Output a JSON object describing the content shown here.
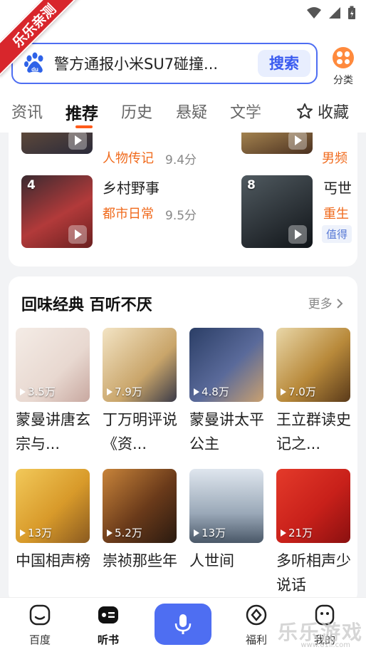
{
  "ribbon": "乐乐亲测",
  "search": {
    "query": "警方通报小米SU7碰撞...",
    "button": "搜索"
  },
  "category": {
    "label": "分类"
  },
  "tabs": [
    {
      "label": "资讯"
    },
    {
      "label": "推荐"
    },
    {
      "label": "历史"
    },
    {
      "label": "悬疑"
    },
    {
      "label": "文学"
    }
  ],
  "collect": {
    "label": "收藏"
  },
  "ranking": [
    {
      "category": "人物传记",
      "score": "9.4分"
    },
    {
      "category": "男频"
    },
    {
      "rank": "4",
      "title": "乡村野事",
      "category": "都市日常",
      "score": "9.5分"
    },
    {
      "rank": "8",
      "title": "丐世",
      "category": "重生",
      "tag": "值得"
    }
  ],
  "section": {
    "title": "回味经典 百听不厌",
    "more": "更多"
  },
  "items": [
    {
      "title": "蒙曼讲唐玄宗与...",
      "plays": "3.5万"
    },
    {
      "title": "丁万明评说《资...",
      "plays": "7.9万"
    },
    {
      "title": "蒙曼讲太平公主",
      "plays": "4.8万"
    },
    {
      "title": "王立群读史记之...",
      "plays": "7.0万"
    },
    {
      "title": "中国相声榜",
      "plays": "13万"
    },
    {
      "title": "崇祯那些年",
      "plays": "5.2万"
    },
    {
      "title": "人世间",
      "plays": "13万"
    },
    {
      "title": "多听相声少说话",
      "plays": "21万"
    }
  ],
  "nav": [
    {
      "label": "百度"
    },
    {
      "label": "听书"
    },
    {
      "label": "福利"
    },
    {
      "label": "我的"
    }
  ],
  "watermark": {
    "text": "乐乐游戏",
    "url": "www.61ll.com"
  },
  "colors": {
    "accent": "#4e6ef2",
    "orange": "#f06a1c",
    "tab_indicator": "#ff5b1a"
  }
}
